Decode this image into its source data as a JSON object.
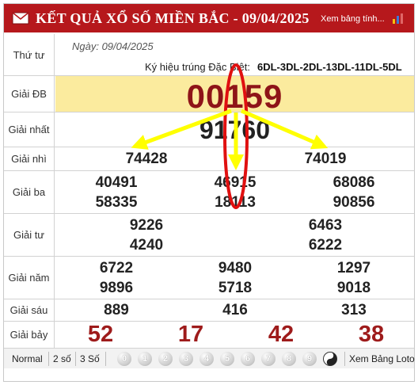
{
  "header": {
    "title": "KẾT QUẢ XỔ SỐ MIỀN BẮC - 09/04/2025",
    "view_table_link": "Xem bảng tính..."
  },
  "info": {
    "weekday": "Thứ tư",
    "date_line": "Ngày: 09/04/2025",
    "special_symbol_label": "Ký hiệu trúng Đặc Biệt:",
    "special_symbol_value": "6DL-3DL-2DL-13DL-11DL-5DL"
  },
  "prizes": {
    "db": {
      "label": "Giải ĐB",
      "numbers": [
        "00159"
      ]
    },
    "nhat": {
      "label": "Giải nhất",
      "numbers": [
        "91760"
      ]
    },
    "nhi": {
      "label": "Giải nhì",
      "numbers": [
        "74428",
        "74019"
      ]
    },
    "ba": {
      "label": "Giải ba",
      "numbers": [
        "40491",
        "46915",
        "68086",
        "58335",
        "18113",
        "90856"
      ]
    },
    "tu": {
      "label": "Giải tư",
      "numbers": [
        "9226",
        "6463",
        "4240",
        "6222"
      ]
    },
    "nam": {
      "label": "Giải năm",
      "numbers": [
        "6722",
        "9480",
        "1297",
        "9896",
        "5718",
        "9018"
      ]
    },
    "sau": {
      "label": "Giải sáu",
      "numbers": [
        "889",
        "416",
        "313"
      ]
    },
    "bay": {
      "label": "Giải bảy",
      "numbers": [
        "52",
        "17",
        "42",
        "38"
      ]
    }
  },
  "toolbar": {
    "normal": "Normal",
    "two_digits": "2 số",
    "three_digits": "3 Số",
    "digits": [
      "0",
      "1",
      "2",
      "3",
      "4",
      "5",
      "6",
      "7",
      "8",
      "9"
    ],
    "loto_link": "Xem Bảng Loto"
  },
  "colors": {
    "header_bg": "#b6181c",
    "special_bg": "#fbeb9e",
    "special_text": "#8e1418",
    "annotation_red": "#e01010",
    "annotation_yellow": "#ffff00"
  },
  "icons": {
    "header_left": "mail-icon",
    "header_right": "bar-chart-icon",
    "last_ball": "yin-yang-icon"
  }
}
